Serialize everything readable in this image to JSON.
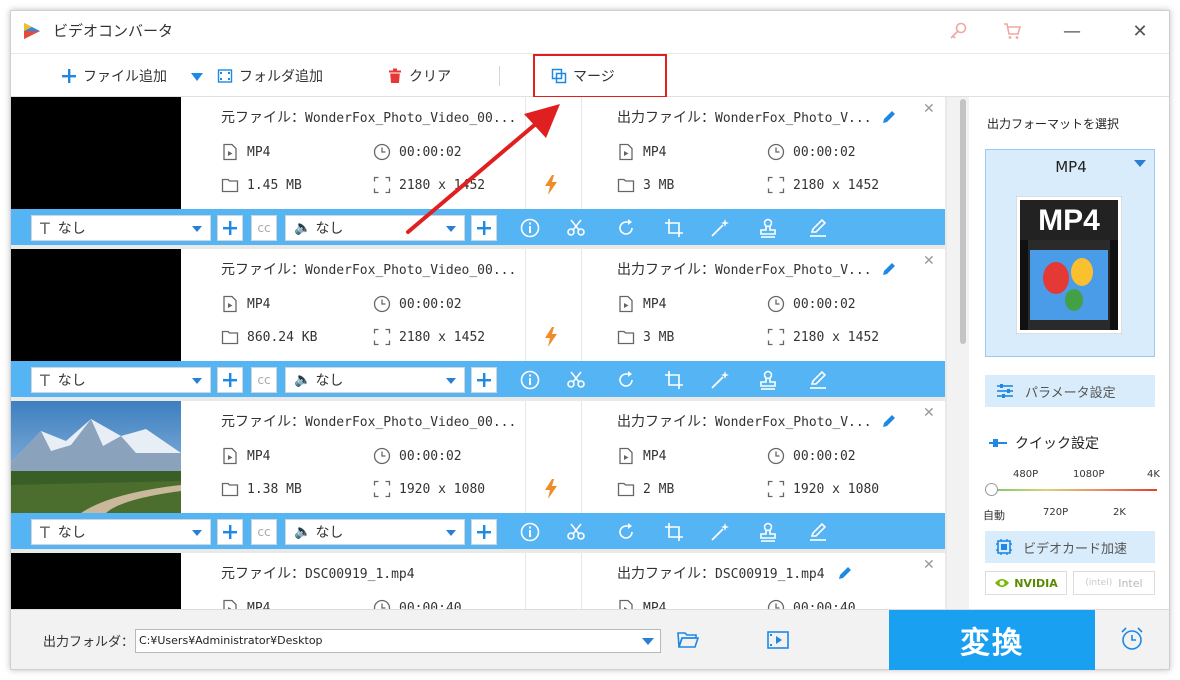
{
  "app": {
    "title": "ビデオコンバータ"
  },
  "toolbar": {
    "add_file": "ファイル追加",
    "add_folder": "フォルダ追加",
    "clear": "クリア",
    "merge": "マージ"
  },
  "files": [
    {
      "source_label": "元ファイル：",
      "source_name": "WonderFox_Photo_Video_00...",
      "output_label": "出力ファイル：",
      "output_name": "WonderFox_Photo_V...",
      "src_format": "MP4",
      "src_duration": "00:00:02",
      "src_size": "1.45 MB",
      "src_resolution": "2180 x 1452",
      "out_format": "MP4",
      "out_duration": "00:00:02",
      "out_size": "3 MB",
      "out_resolution": "2180 x 1452",
      "subtitle": "なし",
      "audio": "なし",
      "thumbnail": "black"
    },
    {
      "source_label": "元ファイル：",
      "source_name": "WonderFox_Photo_Video_00...",
      "output_label": "出力ファイル：",
      "output_name": "WonderFox_Photo_V...",
      "src_format": "MP4",
      "src_duration": "00:00:02",
      "src_size": "860.24 KB",
      "src_resolution": "2180 x 1452",
      "out_format": "MP4",
      "out_duration": "00:00:02",
      "out_size": "3 MB",
      "out_resolution": "2180 x 1452",
      "subtitle": "なし",
      "audio": "なし",
      "thumbnail": "black"
    },
    {
      "source_label": "元ファイル：",
      "source_name": "WonderFox_Photo_Video_00...",
      "output_label": "出力ファイル：",
      "output_name": "WonderFox_Photo_V...",
      "src_format": "MP4",
      "src_duration": "00:00:02",
      "src_size": "1.38 MB",
      "src_resolution": "1920 x 1080",
      "out_format": "MP4",
      "out_duration": "00:00:02",
      "out_size": "2 MB",
      "out_resolution": "1920 x 1080",
      "subtitle": "なし",
      "audio": "なし",
      "thumbnail": "mountain"
    },
    {
      "source_label": "元ファイル：",
      "source_name": "DSC00919_1.mp4",
      "output_label": "出力ファイル：",
      "output_name": "DSC00919_1.mp4",
      "src_format": "MP4",
      "src_duration": "00:00:40",
      "out_format": "MP4",
      "out_duration": "00:00:40",
      "thumbnail": "black"
    }
  ],
  "bottom": {
    "output_folder_label": "出力フォルダ：",
    "output_path": "C:¥Users¥Administrator¥Desktop",
    "convert": "変換"
  },
  "right_panel": {
    "title": "出力フォーマットを選択",
    "format": "MP4",
    "format_icon_text": "MP4",
    "param_settings": "パラメータ設定",
    "quick_settings": "クイック設定",
    "quality_top": [
      "480P",
      "1080P",
      "4K"
    ],
    "quality_bottom": [
      "自動",
      "720P",
      "2K"
    ],
    "quality_level": "自動",
    "gpu_accel": "ビデオカード加速",
    "nvidia": "NVIDIA",
    "intel": "Intel"
  },
  "colors": {
    "accent": "#1aa0f0",
    "option_bar": "#55b4f4",
    "highlight": "#e02020",
    "bolt": "#f08c28"
  }
}
